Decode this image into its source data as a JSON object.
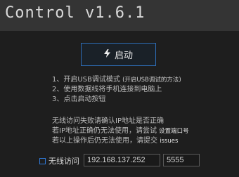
{
  "header": {
    "title": "Control v1.6.1"
  },
  "start_button": {
    "label": "启动",
    "icon": "bolt-icon"
  },
  "instructions": {
    "step1_main": "1、开启USB调试模式",
    "step1_hint": "(开启USB调试的方法)",
    "step2": "2、使用数据线将手机连接到电脑上",
    "step3": "3、点击启动按钮"
  },
  "notes": {
    "line1": "无线访问失败请确认IP地址是否正确",
    "line2_main": "若IP地址正确仍无法使用，请尝试",
    "line2_link": "设置端口号",
    "line3_main": "若以上操作后仍无法使用，请提交",
    "line3_link": "issues"
  },
  "wireless": {
    "label": "无线访问",
    "checked": false,
    "ip_value": "192.168.137.252",
    "port_value": "5555"
  },
  "colors": {
    "accent": "#2e6cb5",
    "header_bg": "#343434",
    "bg": "#1e1e1e"
  }
}
